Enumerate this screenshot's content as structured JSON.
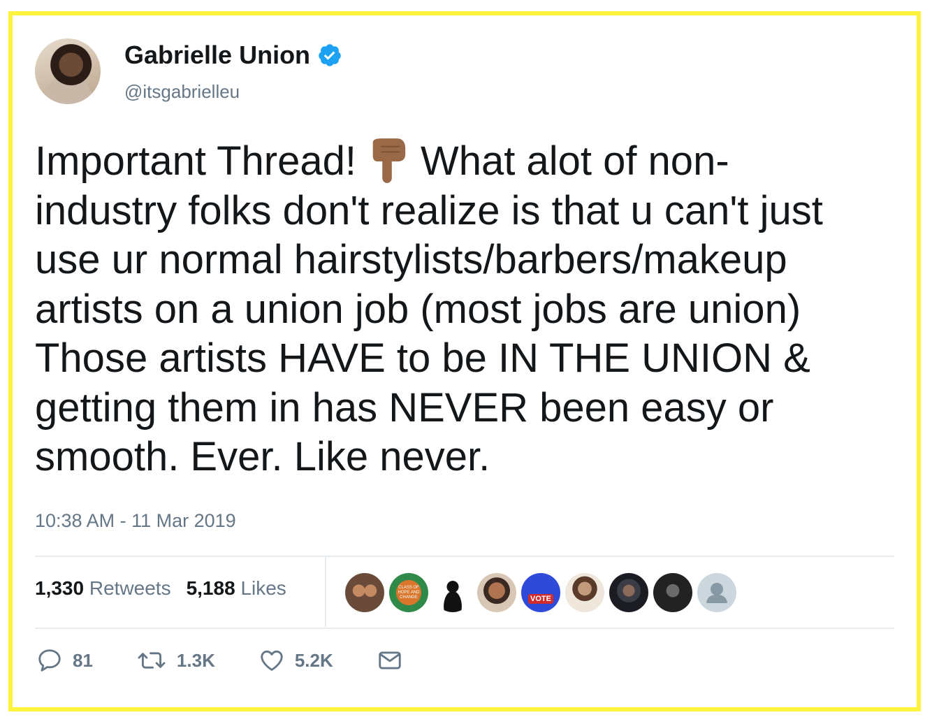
{
  "author": {
    "name": "Gabrielle Union",
    "handle": "@itsgabrielleu"
  },
  "tweet": {
    "lines": [
      [
        "Important Thread!",
        "What alot of non-"
      ],
      "industry folks don't realize is that u can't just",
      "use ur normal hairstylists/barbers/makeup",
      "artists on a union job (most jobs are union)",
      "Those artists HAVE to be IN THE UNION &",
      "getting them in has NEVER been easy or",
      "smooth. Ever. Like never."
    ],
    "emoji": "backhand-index-pointing-down",
    "timestamp": "10:38 AM - 11 Mar 2019"
  },
  "stats": {
    "retweets_count": "1,330",
    "retweets_label": "Retweets",
    "likes_count": "5,188",
    "likes_label": "Likes"
  },
  "likers": [
    {
      "icon": "liker-avatar-1"
    },
    {
      "icon": "liker-avatar-2",
      "text": "CLASS OF HOPE AND CHANGE"
    },
    {
      "icon": "liker-avatar-3"
    },
    {
      "icon": "liker-avatar-4"
    },
    {
      "icon": "liker-avatar-5",
      "text": "VOTE"
    },
    {
      "icon": "liker-avatar-6"
    },
    {
      "icon": "liker-avatar-7"
    },
    {
      "icon": "liker-avatar-8"
    },
    {
      "icon": "default-avatar"
    }
  ],
  "actions": {
    "replies": "81",
    "retweets": "1.3K",
    "likes": "5.2K"
  },
  "colors": {
    "frame": "#fdf33f",
    "verified": "#1da1f2",
    "secondary_text": "#657786",
    "divider": "#e6ecf0"
  }
}
